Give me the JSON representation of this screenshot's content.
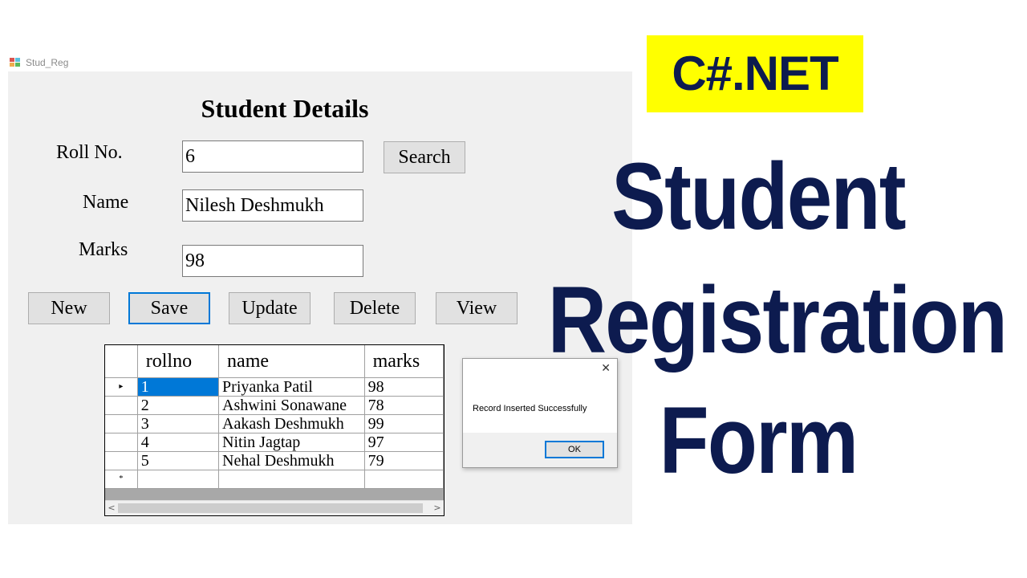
{
  "window": {
    "title": "Stud_Reg"
  },
  "form": {
    "heading": "Student Details",
    "fields": {
      "rollno": {
        "label": "Roll No.",
        "value": "6"
      },
      "name": {
        "label": "Name",
        "value": "Nilesh Deshmukh"
      },
      "marks": {
        "label": "Marks",
        "value": "98"
      }
    },
    "search_label": "Search",
    "buttons": {
      "new": "New",
      "save": "Save",
      "update": "Update",
      "delete": "Delete",
      "view": "View"
    }
  },
  "grid": {
    "columns": [
      "rollno",
      "name",
      "marks"
    ],
    "current_row_marker": "▸",
    "new_row_marker": "*",
    "rows": [
      {
        "rollno": "1",
        "name": "Priyanka Patil",
        "marks": "98"
      },
      {
        "rollno": "2",
        "name": "Ashwini Sonawane",
        "marks": "78"
      },
      {
        "rollno": "3",
        "name": "Aakash Deshmukh",
        "marks": "99"
      },
      {
        "rollno": "4",
        "name": "Nitin Jagtap",
        "marks": "97"
      },
      {
        "rollno": "5",
        "name": "Nehal Deshmukh",
        "marks": "79"
      }
    ]
  },
  "messagebox": {
    "message": "Record Inserted Successfully",
    "ok_label": "OK"
  },
  "banner": {
    "badge": "C#.NET",
    "line1": "Student",
    "line2": "Registration",
    "line3": "Form"
  },
  "colors": {
    "badge_bg": "#ffff00",
    "banner_text": "#0d1b4f",
    "selection": "#0078d7",
    "form_bg": "#f0f0f0"
  }
}
